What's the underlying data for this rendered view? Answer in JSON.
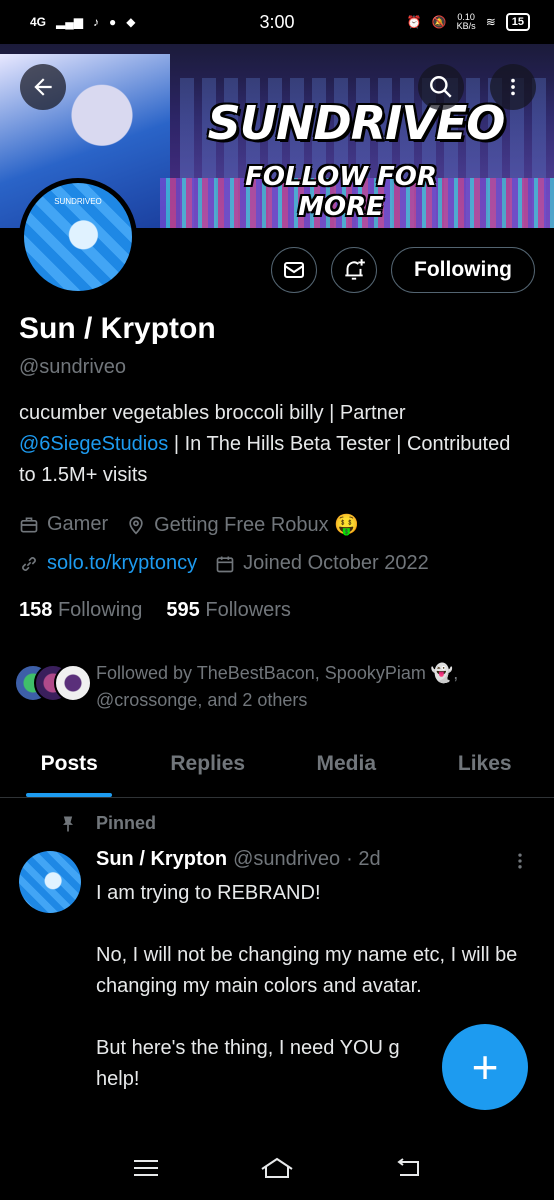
{
  "status": {
    "network": "4G",
    "time": "3:00",
    "speed_value": "0.10",
    "speed_unit": "KB/s",
    "battery": "15"
  },
  "banner": {
    "title": "SUNDRIVEO",
    "subtitle": "FOLLOW FOR MORE",
    "avatar_label": "SUNDRIVEO"
  },
  "profile": {
    "name": "Sun / Krypton",
    "handle": "@sundriveo",
    "follow_label": "Following",
    "bio_part1": "cucumber vegetables broccoli billy | Partner ",
    "bio_mention": "@6SiegeStudios",
    "bio_part2": " | In The Hills Beta Tester | Contributed to 1.5M+ visits",
    "category": "Gamer",
    "location": "Getting Free Robux 🤑",
    "website": "solo.to/kryptoncy",
    "joined": "Joined October 2022",
    "following_count": "158",
    "following_label": "Following",
    "followers_count": "595",
    "followers_label": "Followers",
    "followed_by": "Followed by TheBestBacon, SpookyPiam 👻, @crossonge, and 2 others"
  },
  "tabs": [
    {
      "label": "Posts"
    },
    {
      "label": "Replies"
    },
    {
      "label": "Media"
    },
    {
      "label": "Likes"
    }
  ],
  "post": {
    "pinned_label": "Pinned",
    "author": "Sun / Krypton",
    "handle": "@sundriveo",
    "time": "· 2d",
    "body": "I am trying to REBRAND!\n\nNo, I will not be changing my name etc, I will be changing my main colors and avatar.\n\nBut here's the thing, I need YOU g\nhelp!"
  },
  "colors": {
    "accent": "#1d9bf0",
    "background": "#000000",
    "muted": "#71767b"
  }
}
